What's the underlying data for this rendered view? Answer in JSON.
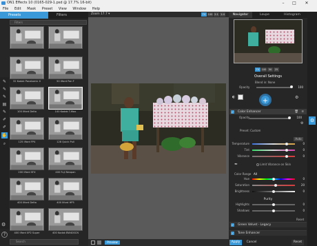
{
  "window": {
    "title": "ON1 Effects 10 (0165-029-1.psd @ 17.7% 16-bit)",
    "minimize": "–",
    "maximize": "□",
    "close": "✕"
  },
  "menu": [
    "File",
    "Edit",
    "Mask",
    "Preset",
    "View",
    "Window",
    "Help"
  ],
  "left": {
    "tabs": {
      "presets": "Presets",
      "filters": "Filters"
    },
    "filter_placeholder": "Filters",
    "search_placeholder": "Search",
    "thumbs": [
      {
        "label": ""
      },
      {
        "label": ""
      },
      {
        "label": "32 Kodak Panatomic X"
      },
      {
        "label": "50 Ilford Pan F"
      },
      {
        "label": "100 Ilford Delta"
      },
      {
        "label": "100 Kodak T-Max"
      },
      {
        "label": "125 Ilford FP4"
      },
      {
        "label": "128 Quick Pull"
      },
      {
        "label": "200 Ilford SFX"
      },
      {
        "label": "400 Fuji Neopan"
      },
      {
        "label": "400 Ilford Delta"
      },
      {
        "label": "400 Ilford HP5"
      },
      {
        "label": "400 Ilford XP2 Super"
      },
      {
        "label": "400 Kodak BW400CN"
      }
    ]
  },
  "center": {
    "zoom_label": "Zoom",
    "zoom_value": "17.7 ▾",
    "view_buttons": [
      "Fit",
      "100",
      "2:1",
      "1:4"
    ],
    "preview_label": "Preview"
  },
  "right": {
    "tabs": [
      "Navigator",
      "Loupe",
      "Histogram"
    ],
    "nav_zoom": [
      "Fit",
      "100",
      "50",
      "25"
    ],
    "overall_title": "Overall Settings",
    "blend_label": "Blend in: None",
    "opacity_label": "Opacity",
    "opacity_value": "100",
    "color_enhancer": {
      "title": "Color Enhancer",
      "opacity_label": "Opacity",
      "opacity_value": "100",
      "preset_label": "Preset: Custom",
      "auto_label": "Auto",
      "sliders": [
        {
          "label": "Temperature",
          "value": "0",
          "level": 0.8
        },
        {
          "label": "Tint",
          "value": "0",
          "level": 0.8
        },
        {
          "label": "Vibrance",
          "value": "0",
          "level": 0.8
        }
      ],
      "limit_label": "Limit Vibrance on Skin",
      "color_range_label": "Color Range",
      "color_range_value": "All",
      "hsb": [
        {
          "label": "Hue",
          "value": "0",
          "level": 0.5
        },
        {
          "label": "Saturation",
          "value": "20",
          "level": 0.55
        },
        {
          "label": "Brightness",
          "value": "0",
          "level": 0.5
        }
      ],
      "purity_label": "Purity",
      "purity": [
        {
          "label": "Highlights",
          "value": "0",
          "level": 0.5
        },
        {
          "label": "Shadows",
          "value": "0",
          "level": 0.5
        }
      ],
      "reset_label": "Reset"
    },
    "stacked_filters": [
      "Green Velvet - Legacy",
      "Tone Enhancer"
    ],
    "apply_label": "Apply",
    "cancel_label": "Cancel",
    "reset_label": "Reset"
  },
  "colors": {
    "accent": "#3a9ad9"
  }
}
